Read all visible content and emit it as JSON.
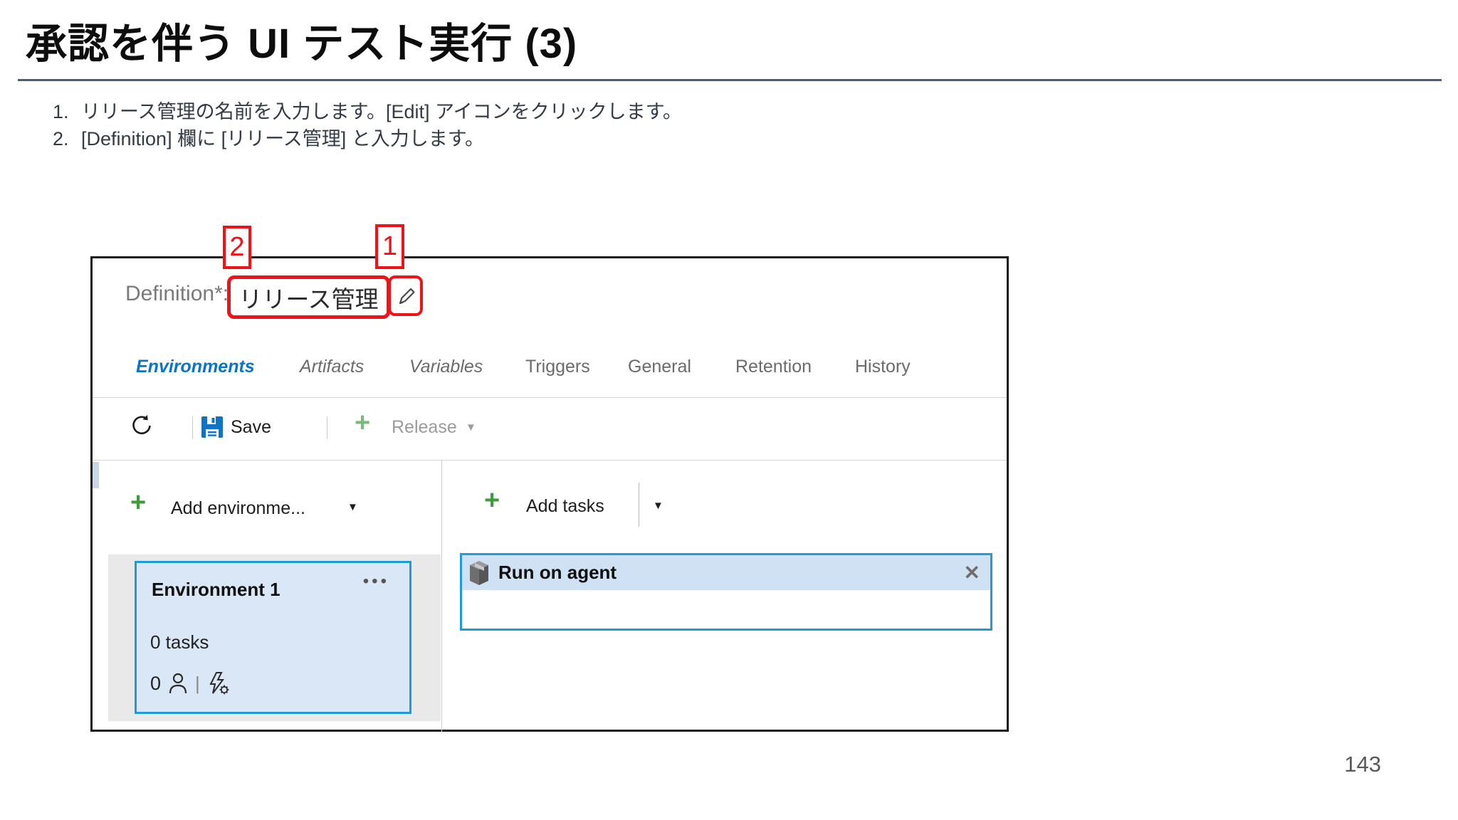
{
  "slide": {
    "title": "承認を伴う UI テスト実行 (3)",
    "page_number": "143",
    "steps": [
      {
        "num": "1.",
        "text": "リリース管理の名前を入力します。[Edit] アイコンをクリックします。"
      },
      {
        "num": "2.",
        "text": "[Definition] 欄に [リリース管理] と入力します。"
      }
    ]
  },
  "annotations": {
    "label_1": "1",
    "label_2": "2",
    "accent_red": "#F01216"
  },
  "app": {
    "definition": {
      "label": "Definition*:",
      "value": "リリース管理"
    },
    "tabs": [
      {
        "label": "Environments"
      },
      {
        "label": "Artifacts"
      },
      {
        "label": "Variables"
      },
      {
        "label": "Triggers"
      },
      {
        "label": "General"
      },
      {
        "label": "Retention"
      },
      {
        "label": "History"
      }
    ],
    "toolbar": {
      "save_label": "Save",
      "release_label": "Release"
    },
    "left_pane": {
      "add_environment_label": "Add environme...",
      "environment": {
        "name": "Environment 1",
        "tasks": "0 tasks",
        "approvers_count": "0"
      }
    },
    "right_pane": {
      "add_tasks_label": "Add tasks",
      "task_group_title": "Run on agent"
    },
    "colors": {
      "active_tab_blue": "#0B74C4",
      "save_icon_blue": "#1173C5",
      "add_green": "#3E9C3E",
      "release_green_disabled": "#7CB97C",
      "card_border_blue": "#1E9BD7",
      "card_bg_blue": "#D9E7F6",
      "task_header_bg": "#CFE1F3",
      "task_border_blue": "#1F9CD8"
    }
  },
  "icons": {
    "caret_down": "▼",
    "plus": "+",
    "ellipsis": "•••",
    "close": "✕",
    "pipe": "|"
  }
}
